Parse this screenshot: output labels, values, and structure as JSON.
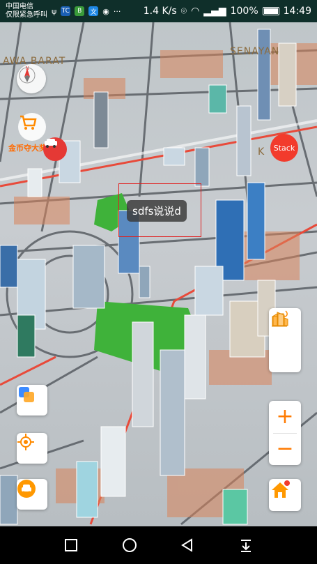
{
  "status_bar": {
    "carrier_line1": "中国电信",
    "carrier_line2": "仅限紧急呼叫",
    "net_speed": "1.4 K/s",
    "battery_pct": "100%",
    "time": "14:49",
    "icons": [
      "usb-icon",
      "tc-app-icon",
      "book-app-icon",
      "translate-app-icon",
      "wechat-icon",
      "more-icon",
      "location-icon",
      "wifi-icon",
      "signal-icon",
      "battery-icon"
    ]
  },
  "map": {
    "labels": {
      "left": "AWA BARAT",
      "right": "SENAYAN",
      "small_right": "K"
    },
    "selected_tooltip": "sdfs说说d",
    "colors": {
      "accent": "#ff7a00",
      "stack": "#f23b2c",
      "park": "#3fb23a",
      "road_red": "#e84a3a"
    }
  },
  "controls": {
    "shop_label": "金币夺大奖",
    "stack_label": "Stack",
    "zoom_in": "+",
    "zoom_out": "−"
  },
  "nav": {
    "icons": [
      "recent-apps-icon",
      "home-circle-icon",
      "back-triangle-icon",
      "notification-pull-icon"
    ]
  }
}
